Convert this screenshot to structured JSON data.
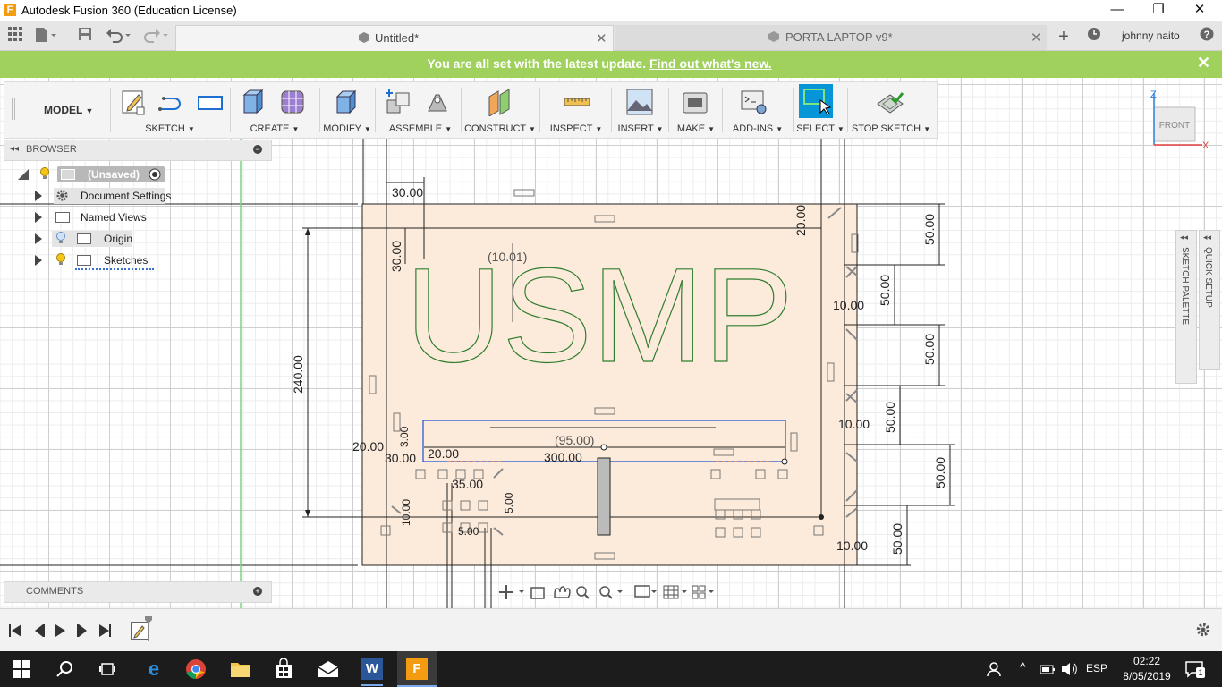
{
  "window": {
    "title": "Autodesk Fusion 360 (Education License)",
    "app_icon": "F",
    "minimize": "—",
    "restore": "❐",
    "close": "✕"
  },
  "tabs": [
    {
      "label": "Untitled*",
      "active": true
    },
    {
      "label": "PORTA LAPTOP v9*",
      "active": false
    }
  ],
  "user": {
    "name": "johnny naito"
  },
  "banner": {
    "message": "You are all set with the latest update.",
    "link": "Find out what's new.",
    "close": "✕",
    "color": "#9fd15c"
  },
  "toolbar": {
    "workspace": "MODEL",
    "groups": [
      "SKETCH",
      "CREATE",
      "MODIFY",
      "ASSEMBLE",
      "CONSTRUCT",
      "INSPECT",
      "INSERT",
      "MAKE",
      "ADD-INS",
      "SELECT",
      "STOP SKETCH"
    ],
    "accent": "#0696d7"
  },
  "browser": {
    "title": "BROWSER",
    "root": "(Unsaved)",
    "items": [
      {
        "label": "Document Settings",
        "icon": "gear-icon"
      },
      {
        "label": "Named Views",
        "icon": "folder-icon"
      },
      {
        "label": "Origin",
        "icon": "folder-icon"
      },
      {
        "label": "Sketches",
        "icon": "folder-icon"
      }
    ]
  },
  "comments": {
    "title": "COMMENTS"
  },
  "viewcube": {
    "face": "FRONT",
    "axis_z": "Z",
    "axis_x": "X"
  },
  "side_palettes": {
    "sketch": "SKETCH PALETTE",
    "quick": "QUICK SETUP"
  },
  "sketch": {
    "text": "USMP",
    "dimensions": {
      "d30_top": "30.00",
      "d30_left": "30.00",
      "d10_01": "(10.01)",
      "d240": "240.00",
      "d20_right_top": "20.00",
      "d50_a": "50.00",
      "d50_b": "50.00",
      "d50_c": "50.00",
      "d50_d": "50.00",
      "d50_e": "50.00",
      "d50_f": "50.00",
      "d10_a": "10.00",
      "d10_b": "10.00",
      "d10_c": "10.00",
      "d10_d": "10.00",
      "d95": "(95.00)",
      "d300": "300.00",
      "d20_left": "20.00",
      "d20_inner": "20.00",
      "d30_mid": "30.00",
      "d3_00": "3.00",
      "d35": "35.00",
      "d5_00": "5.00",
      "d10_lower": "10.00",
      "d5_00_b": "5.00"
    }
  },
  "taskbar": {
    "language": "ESP",
    "time": "02:22",
    "date": "8/05/2019",
    "notifications": "1"
  }
}
